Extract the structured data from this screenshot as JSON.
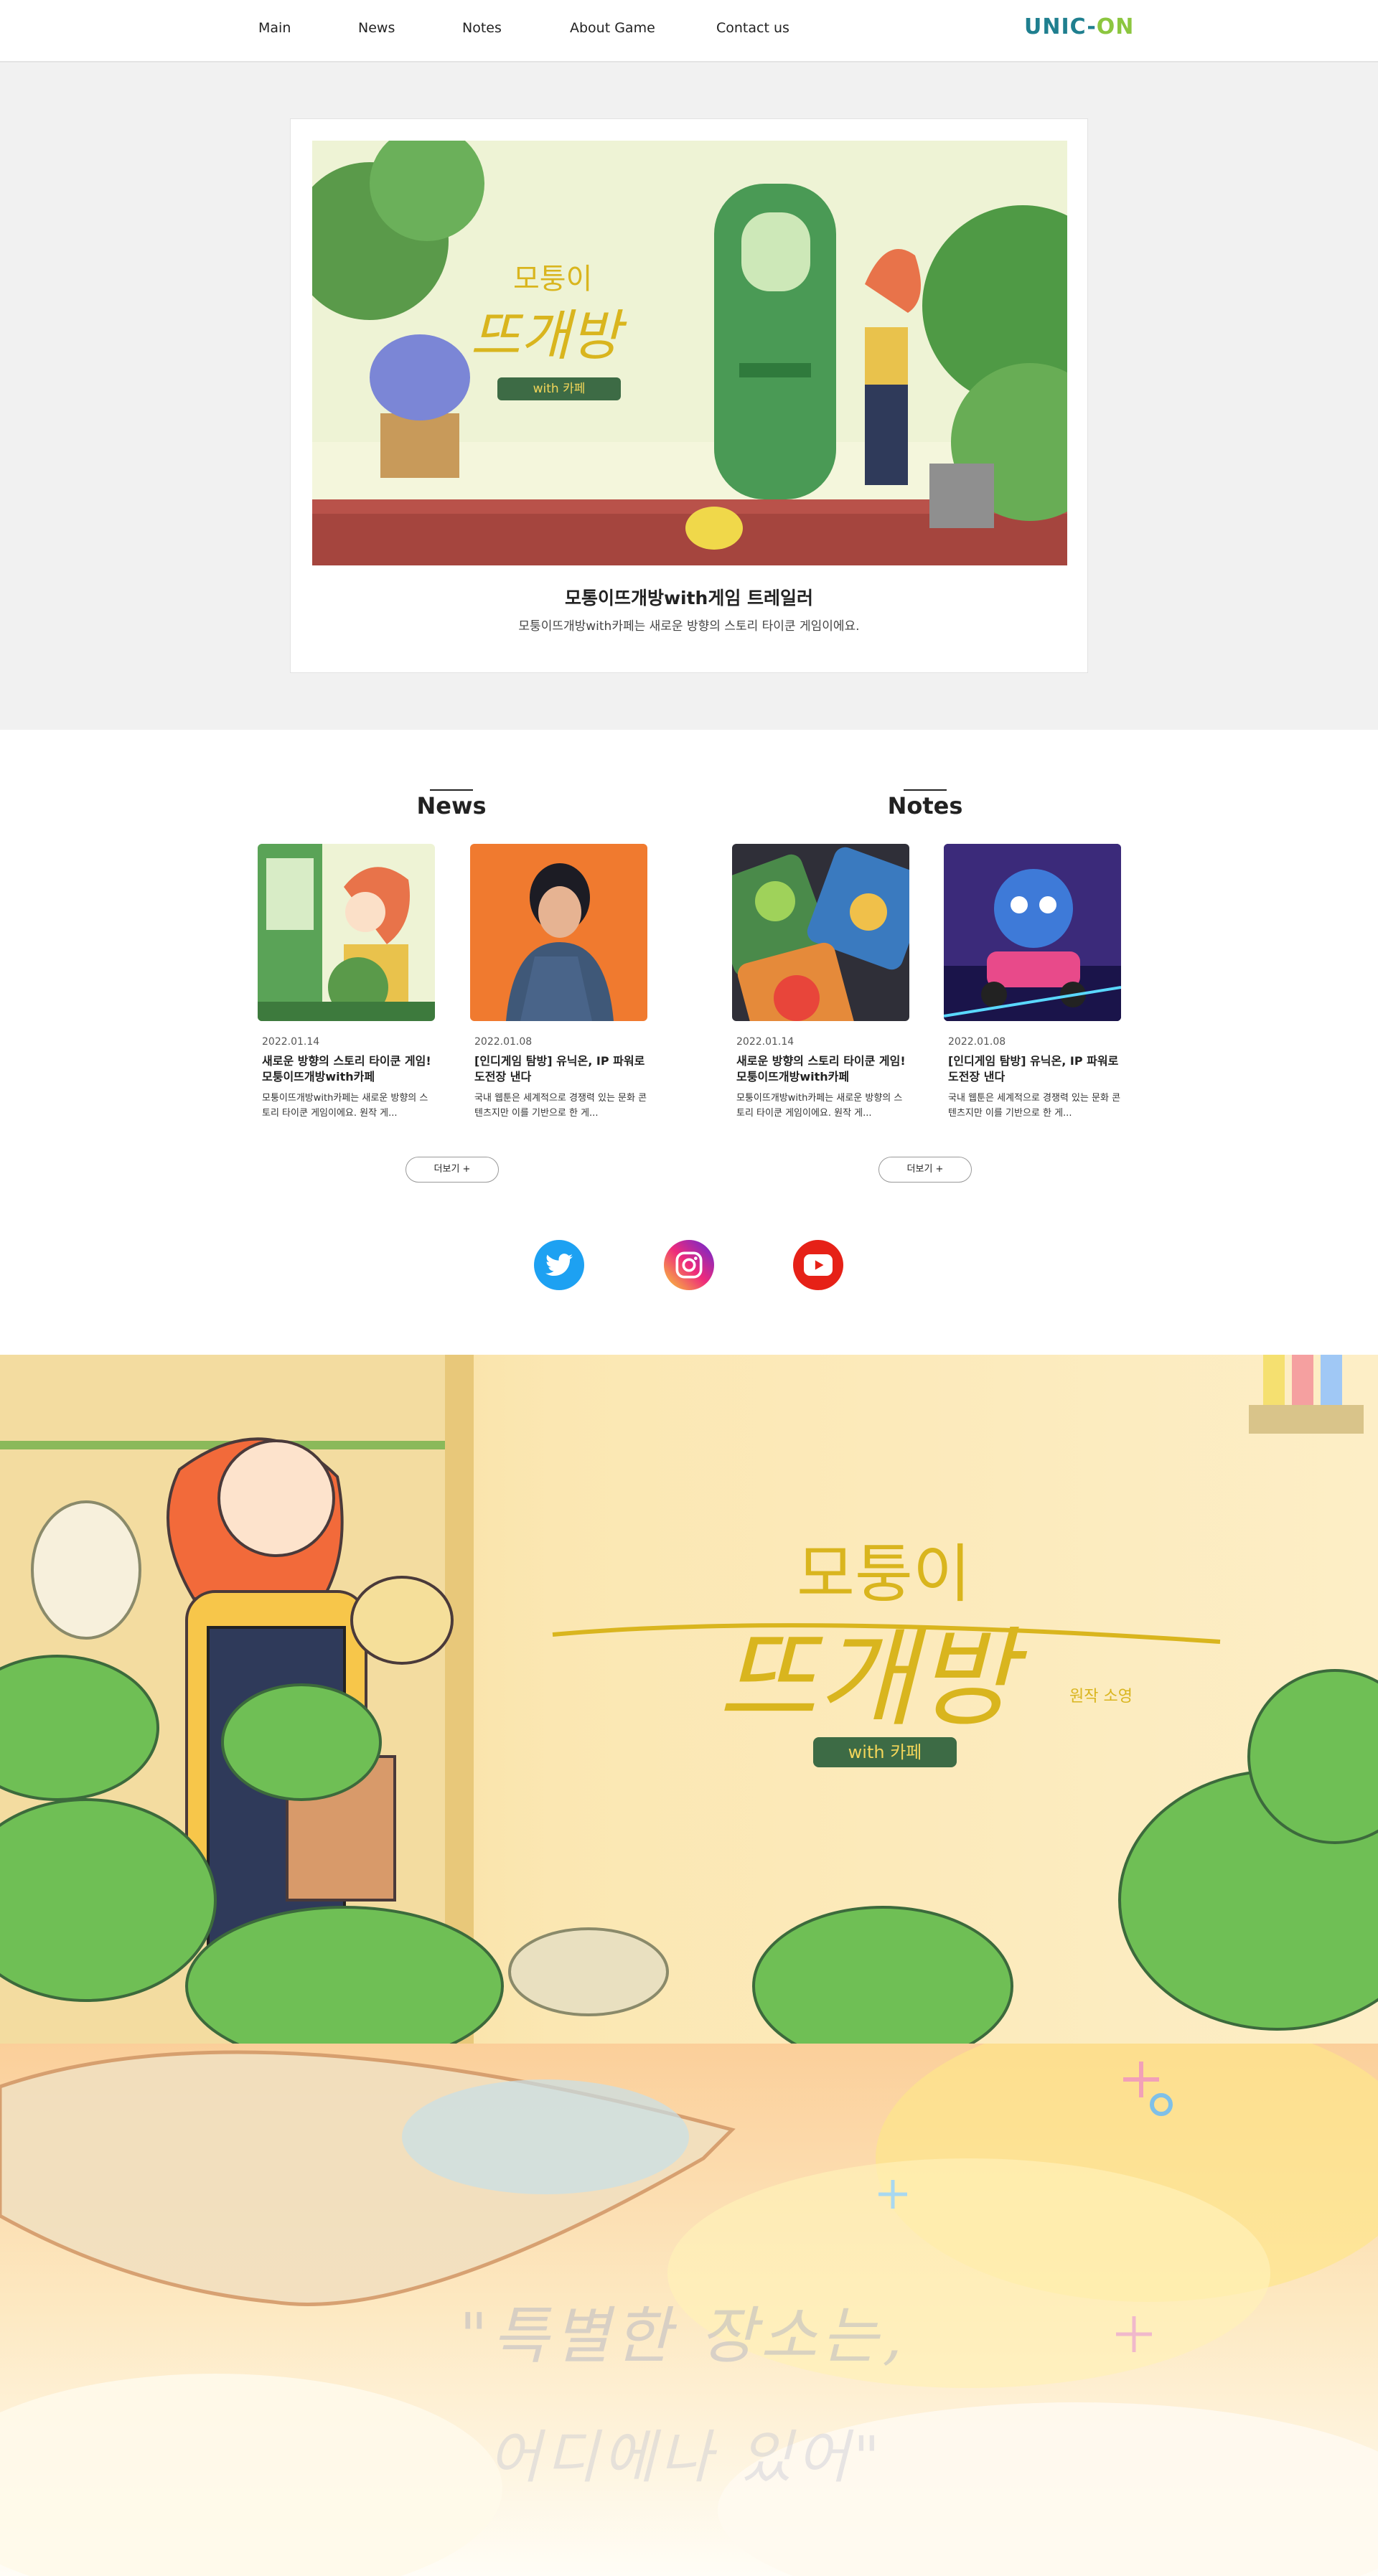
{
  "nav": {
    "items": [
      "Main",
      "News",
      "Notes",
      "About Game",
      "Contact us"
    ],
    "logo_part1": "UNIC-",
    "logo_part2": "ON"
  },
  "hero": {
    "title": "모통이뜨개방with게임 트레일러",
    "description": "모퉁이뜨개방with카페는 새로운 방향의 스토리 타이쿤 게임이에요.",
    "art_title_top": "모퉁이",
    "art_title_main": "뜨개방",
    "art_badge": "with 카페"
  },
  "news": {
    "heading": "News",
    "more_label": "더보기 +",
    "items": [
      {
        "date": "2022.01.14",
        "title": "새로운 방향의 스토리 타이쿤 게임! 모퉁이뜨개방with카페",
        "desc": "모퉁이뜨개방with카페는 새로운 방향의 스토리 타이쿤 게임이에요. 원작 게..."
      },
      {
        "date": "2022.01.08",
        "title": "[인디게임 탐방] 유닉온, IP 파워로 도전장 낸다",
        "desc": "국내 웹툰은 세계적으로 경쟁력 있는 문화 콘텐츠지만 이를 기반으로 한 게..."
      }
    ]
  },
  "notes": {
    "heading": "Notes",
    "more_label": "더보기 +",
    "items": [
      {
        "date": "2022.01.14",
        "title": "새로운 방향의 스토리 타이쿤 게임! 모퉁이뜨개방with카페",
        "desc": "모퉁이뜨개방with카페는 새로운 방향의 스토리 타이쿤 게임이에요. 원작 게..."
      },
      {
        "date": "2022.01.08",
        "title": "[인디게임 탐방] 유닉온, IP 파워로 도전장 낸다",
        "desc": "국내 웹툰은 세계적으로 경쟁력 있는 문화 콘텐츠지만 이를 기반으로 한 게..."
      }
    ]
  },
  "social": {
    "icons": [
      "twitter-icon",
      "instagram-icon",
      "youtube-icon"
    ],
    "colors": {
      "twitter": "#1da1f2",
      "youtube": "#e62117"
    }
  },
  "banner1": {
    "title_top": "모퉁이",
    "title_main": "뜨개방",
    "subtitle": "원작 소영",
    "badge": "with 카페"
  },
  "banner2": {
    "quote_line1": "\"특별한 장소는,",
    "quote_line2": "어디에나 있어\""
  },
  "colors": {
    "logo_teal": "#1f7f8f",
    "logo_green": "#8cc63f",
    "hero_bg": "#f1f1f1",
    "title_gold": "#d9b51e"
  }
}
